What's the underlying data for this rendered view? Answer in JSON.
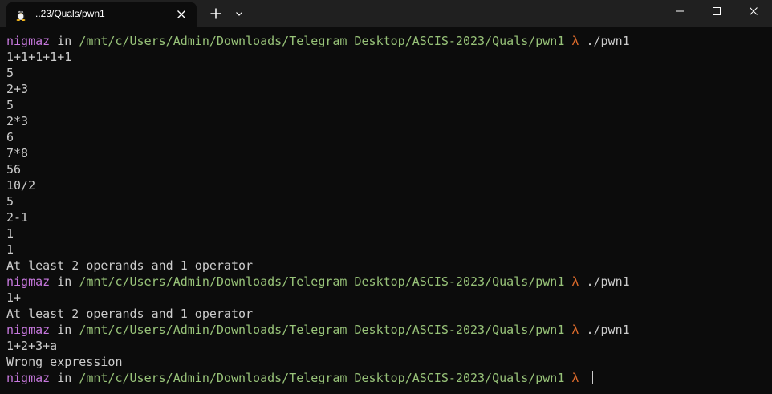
{
  "window": {
    "tab_title": "..23/Quals/pwn1",
    "tab_icon": "linux-penguin-icon",
    "new_tab_icon": "plus-icon",
    "dropdown_icon": "chevron-down-icon",
    "close_tab_icon": "close-icon",
    "controls": [
      "minimize-icon",
      "maximize-icon",
      "close-icon"
    ]
  },
  "colors": {
    "user": "#c678dd",
    "path": "#98c379",
    "lambda": "#e06c2c",
    "text": "#cccccc",
    "background": "#0c0c0c",
    "titlebar": "#202020"
  },
  "prompt": {
    "user": "nigmaz",
    "in": " in ",
    "path": "/mnt/c/Users/Admin/Downloads/Telegram Desktop/ASCIS-2023/Quals/pwn1",
    "symbol": " λ "
  },
  "lines": [
    {
      "type": "prompt",
      "cmd": "./pwn1"
    },
    {
      "type": "text",
      "text": "1+1+1+1+1"
    },
    {
      "type": "text",
      "text": "5"
    },
    {
      "type": "text",
      "text": "2+3"
    },
    {
      "type": "text",
      "text": "5"
    },
    {
      "type": "text",
      "text": "2*3"
    },
    {
      "type": "text",
      "text": "6"
    },
    {
      "type": "text",
      "text": "7*8"
    },
    {
      "type": "text",
      "text": "56"
    },
    {
      "type": "text",
      "text": "10/2"
    },
    {
      "type": "text",
      "text": "5"
    },
    {
      "type": "text",
      "text": "2-1"
    },
    {
      "type": "text",
      "text": "1"
    },
    {
      "type": "text",
      "text": "1"
    },
    {
      "type": "text",
      "text": "At least 2 operands and 1 operator"
    },
    {
      "type": "prompt",
      "cmd": "./pwn1"
    },
    {
      "type": "text",
      "text": "1+"
    },
    {
      "type": "text",
      "text": "At least 2 operands and 1 operator"
    },
    {
      "type": "prompt",
      "cmd": "./pwn1"
    },
    {
      "type": "text",
      "text": "1+2+3+a"
    },
    {
      "type": "text",
      "text": "Wrong expression"
    },
    {
      "type": "prompt",
      "cmd": "",
      "cursor": true
    }
  ]
}
